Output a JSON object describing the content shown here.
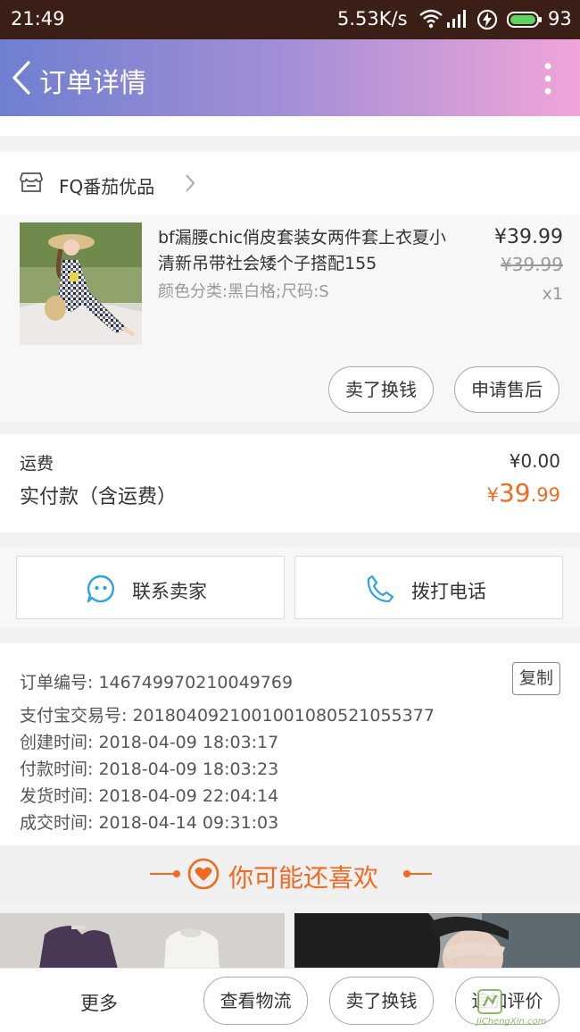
{
  "status_bar": {
    "time": "21:49",
    "net_speed": "5.53K/s",
    "battery": "93"
  },
  "header": {
    "title": "订单详情"
  },
  "shop": {
    "name": "FQ番茄优品"
  },
  "product": {
    "title": "bf漏腰chic俏皮套装女两件套上衣夏小清新吊带社会矮个子搭配155",
    "spec": "颜色分类:黑白格;尺码:S",
    "price": "¥39.99",
    "original_price": "¥39.99",
    "quantity": "x1",
    "actions": [
      "卖了换钱",
      "申请售后"
    ]
  },
  "fees": {
    "shipping_label": "运费",
    "shipping_value": "¥0.00",
    "paid_label": "实付款（含运费）",
    "paid_currency": "¥",
    "paid_integer": "39",
    "paid_decimal": ".99"
  },
  "contact": {
    "seller": "联系卖家",
    "phone": "拨打电话"
  },
  "order_info": {
    "copy_label": "复制",
    "lines": [
      "订单编号: 146749970210049769",
      "支付宝交易号: 2018040921001001080521055377",
      "创建时间: 2018-04-09 18:03:17",
      "付款时间: 2018-04-09 18:03:23",
      "发货时间: 2018-04-09 22:04:14",
      "成交时间: 2018-04-14 09:31:03"
    ]
  },
  "recommend": {
    "title": "你可能还喜欢"
  },
  "bottom_bar": {
    "more": "更多",
    "buttons": [
      "查看物流",
      "卖了换钱",
      "追加评价"
    ]
  },
  "watermark": {
    "text": "JiChengXin.com"
  },
  "colors": {
    "accent": "#f06b21",
    "header_start": "#6f7fd0",
    "header_end": "#f1a5d9",
    "icon_blue": "#2ba3e6"
  }
}
